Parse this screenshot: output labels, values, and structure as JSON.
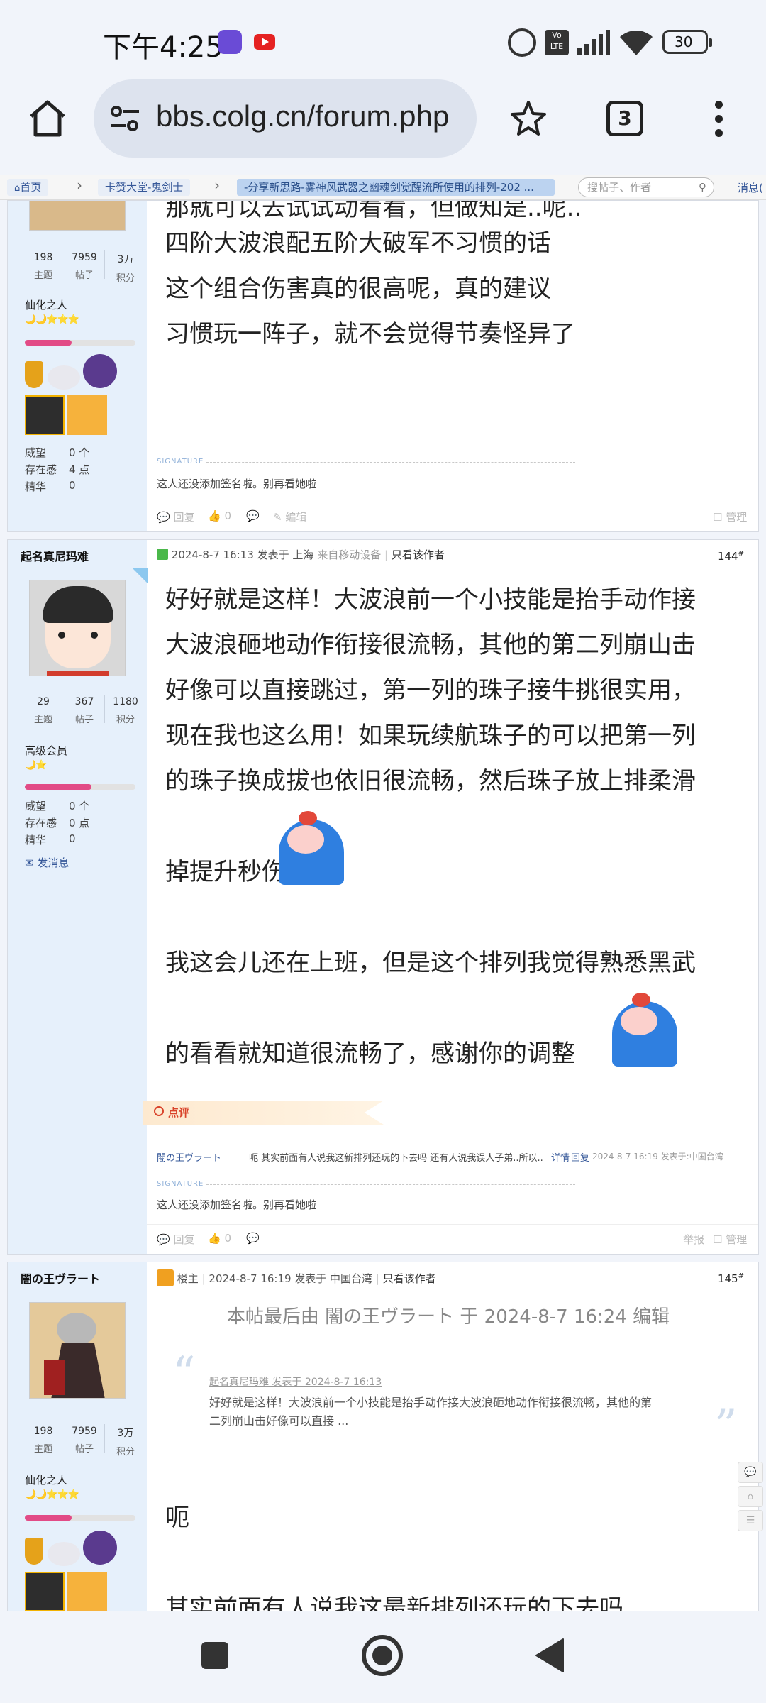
{
  "status_bar": {
    "time": "下午4:25",
    "battery": "30"
  },
  "browser": {
    "url": "bbs.colg.cn/forum.php",
    "tab_count": "3"
  },
  "breadcrumb": {
    "home": "首页",
    "section": "卡赞大堂-鬼剑士",
    "current": "-分享新思路-雾神风武器之幽魂剑觉醒流所使用的排列-202 ...",
    "search_placeholder": "搜帖子、作者",
    "messages": "消息("
  },
  "post1": {
    "stats": [
      {
        "value": "198",
        "label": "主题"
      },
      {
        "value": "7959",
        "label": "帖子"
      },
      {
        "value": "3万",
        "label": "积分"
      }
    ],
    "rank": "仙化之人",
    "stars": "🌙🌙⭐⭐⭐",
    "level_fill": 0.42,
    "prestige": {
      "label": "威望",
      "value": "0 个"
    },
    "presence": {
      "label": "存在感",
      "value": "4 点"
    },
    "essence": {
      "label": "精华",
      "value": "0"
    },
    "lines": [
      "那就可以去试试动看看，但做知是..呢..",
      "四阶大波浪配五阶大破军不习惯的话",
      "这个组合伤害真的很高呢，真的建议",
      "习惯玩一阵子，就不会觉得节奏怪异了"
    ],
    "signature_tag": "SIGNATURE",
    "signature": "这人还没添加签名啦。别再看她啦",
    "footer": {
      "reply": "回复",
      "likes": "0",
      "edit": "编辑",
      "manage": "管理"
    }
  },
  "post2": {
    "username": "起名真尼玛难",
    "stats": [
      {
        "value": "29",
        "label": "主题"
      },
      {
        "value": "367",
        "label": "帖子"
      },
      {
        "value": "1180",
        "label": "积分"
      }
    ],
    "rank": "高级会员",
    "stars": "🌙⭐",
    "level_fill": 0.6,
    "prestige": {
      "label": "威望",
      "value": "0 个"
    },
    "presence": {
      "label": "存在感",
      "value": "0 点"
    },
    "essence": {
      "label": "精华",
      "value": "0"
    },
    "send_msg": "发消息",
    "meta": "2024-8-7 16:13 发表于 上海",
    "device": "来自移动设备",
    "only_author": "只看该作者",
    "floor": "144",
    "lines": [
      "好好就是这样！大波浪前一个小技能是抬手动作接",
      "大波浪砸地动作衔接很流畅，其他的第二列崩山击",
      "好像可以直接跳过，第一列的珠子接牛挑很实用，",
      "现在我也这么用！如果玩续航珠子的可以把第一列",
      "的珠子换成拔也依旧很流畅，然后珠子放上排柔滑",
      "掉提升秒伤",
      "我这会儿还在上班，但是这个排列我觉得熟悉黑武",
      "的看看就知道很流畅了，感谢你的调整"
    ],
    "comment_title": "点评",
    "comment": {
      "author": "闇の王ヴラート",
      "text": "呃 其实前面有人说我这新排列还玩的下去吗 还有人说我误人子弟..所以..",
      "detail": "详情",
      "reply": "回复",
      "time": "2024-8-7 16:19 发表于:中国台湾"
    },
    "signature_tag": "SIGNATURE",
    "signature": "这人还没添加签名啦。别再看她啦",
    "footer": {
      "reply": "回复",
      "likes": "0",
      "report": "举报",
      "manage": "管理"
    }
  },
  "post3": {
    "username": "闇の王ヴラート",
    "stats": [
      {
        "value": "198",
        "label": "主题"
      },
      {
        "value": "7959",
        "label": "帖子"
      },
      {
        "value": "3万",
        "label": "积分"
      }
    ],
    "rank": "仙化之人",
    "stars": "🌙🌙⭐⭐⭐",
    "level_fill": 0.42,
    "owner": "楼主",
    "meta": "2024-8-7 16:19 发表于 中国台湾",
    "only_author": "只看该作者",
    "floor": "145",
    "edited": "本帖最后由 闇の王ヴラート 于 2024-8-7 16:24 编辑",
    "quote_head": "起名真尼玛难 发表于 2024-8-7 16:13",
    "quote_l1": "好好就是这样！大波浪前一个小技能是抬手动作接大波浪砸地动作衔接很流畅，其他的第",
    "quote_l2": "二列崩山击好像可以直接 ...",
    "line1": "呃",
    "line2": "其实前面有人说我这最新排列还玩的下去吗"
  }
}
